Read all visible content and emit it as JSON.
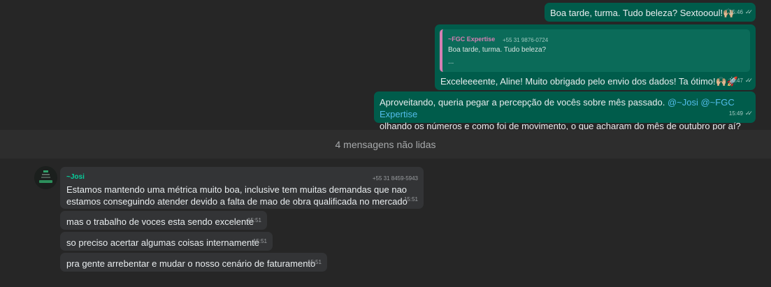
{
  "outgoing": [
    {
      "text": "Boa tarde, turma. Tudo beleza? Sextoooul!🙌🏼",
      "time": "15:46"
    },
    {
      "quote": {
        "author": "~FGC Expertise",
        "phone": "+55 31 9876-0724",
        "line1": "Boa tarde, turma. Tudo beleza?",
        "line2": "..."
      },
      "text": "Exceleeeente, Aline! Muito obrigado pelo envio dos dados! Ta ótimo!🙌🏼🚀",
      "time": "15:47"
    },
    {
      "text_before": "Aproveitando, queria pegar a percepção de vocês sobre mês passado. ",
      "mention1": "@~Josi",
      "mention2": "@~FGC Expertise",
      "text_after": "olhando os números e como foi de movimento, o que acharam do mês de outubro por aí?",
      "time": "15:49"
    }
  ],
  "unread_label": "4 mensagens não lidas",
  "incoming": {
    "sender": "~Josi",
    "phone": "+55 31 8459-5943",
    "messages": [
      {
        "text": "Estamos mantendo uma métrica muito boa, inclusive tem muitas demandas que nao estamos conseguindo atender devido a falta de mao de obra qualificada no mercado",
        "time": "15:51"
      },
      {
        "text": "mas o trabalho de voces esta sendo excelente",
        "time": "15:51"
      },
      {
        "text": "so preciso acertar algumas coisas internamente",
        "time": "15:51"
      },
      {
        "text": "pra gente arrebentar e mudar o nosso cenário de faturamento",
        "time": "15:51"
      }
    ]
  },
  "colors": {
    "outgoing_bubble": "#005c4b",
    "incoming_bubble": "#333436",
    "quote_accent": "#d57fb3",
    "sender_name": "#06cf9c",
    "mention": "#53bdeb"
  },
  "icons": {
    "read_receipt": "double-check-icon",
    "avatar": "avatar-logo"
  }
}
